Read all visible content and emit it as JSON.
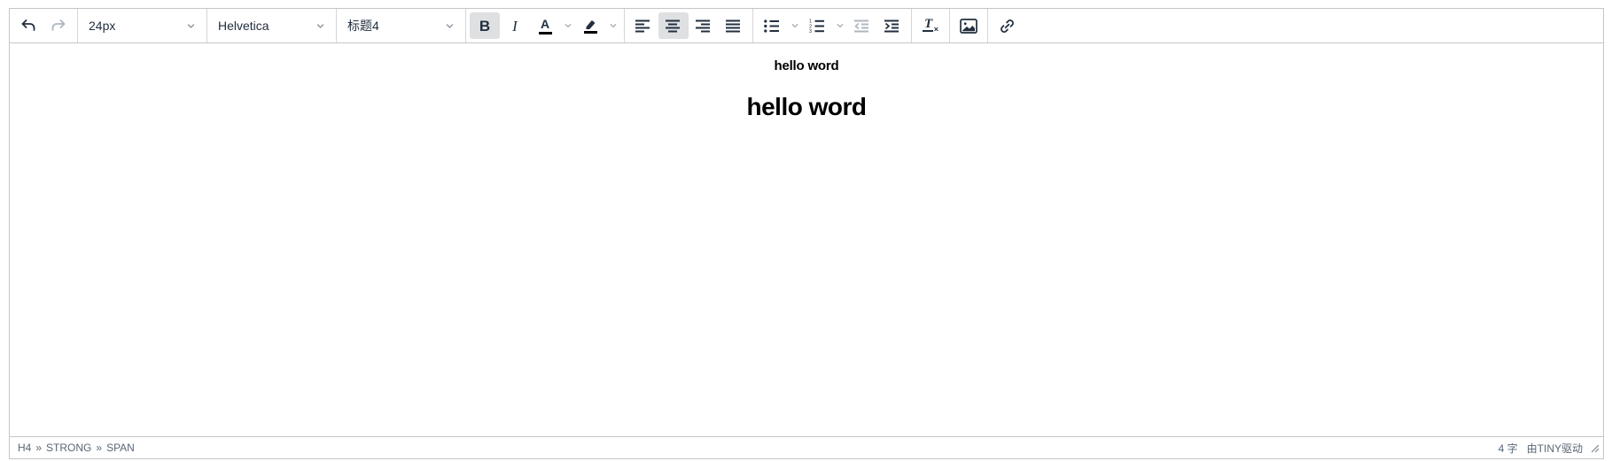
{
  "toolbar": {
    "font_size": "24px",
    "font_family": "Helvetica",
    "block_format": "标题4",
    "bold_label": "B",
    "italic_label": "I",
    "forecolor_label": "A",
    "removeformat_label": "T",
    "removeformat_x": "×",
    "numlist_digits": [
      "1",
      "2",
      "3"
    ]
  },
  "content": {
    "paragraph_text": "hello word",
    "heading_text": "hello word"
  },
  "statusbar": {
    "element_path": [
      "H4",
      "STRONG",
      "SPAN"
    ],
    "path_separator": "»",
    "word_count": "4 字",
    "branding": "由TINY驱动"
  },
  "colors": {
    "icon": "#222f3e",
    "icon_disabled": "#aeb6be",
    "active_button_bg": "#dee0e2",
    "frame_border": "#c6c6c6",
    "color_swatch": "#000000",
    "statusbar_text": "#5a6675"
  }
}
